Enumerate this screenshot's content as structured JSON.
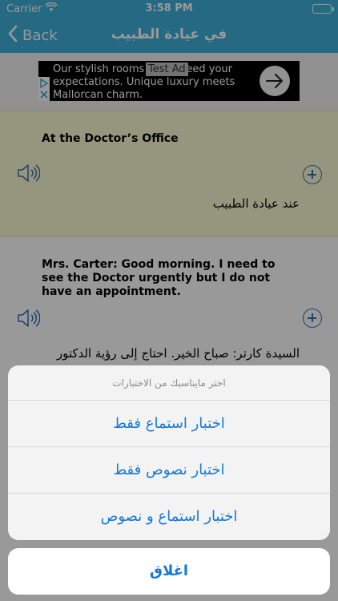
{
  "status_bar": {
    "carrier": "Carrier",
    "time": "3:58 PM",
    "wifi_icon": "wifi-icon",
    "battery_icon": "battery-icon"
  },
  "nav": {
    "back_label": "Back",
    "title": "في عيادة الطبيب"
  },
  "ad": {
    "text": "Our stylish rooms will exceed your expectations. Unique luxury meets Mallorcan charm.",
    "badge": "Test Ad"
  },
  "cards": [
    {
      "english": "At the Doctor’s Office",
      "arabic": "عند عيادة الطبيب"
    },
    {
      "english": "Mrs. Carter: Good morning. I need to see the Doctor urgently but I do not have an appointment.",
      "arabic": "السيدة كارتر: صباح الخير. احتاج إلى رؤية الدكتور"
    }
  ],
  "action_sheet": {
    "message": "اختر مايناسبك من الاختبارات",
    "options": [
      "اختبار استماع فقط",
      "اختبار نصوص فقط",
      "اختبار استماع و نصوص"
    ],
    "cancel": "اغلاق"
  },
  "colors": {
    "nav": "#3fb0d9",
    "card_highlight": "#fafad2",
    "accent": "#2f6fb6",
    "action": "#1479d9"
  }
}
